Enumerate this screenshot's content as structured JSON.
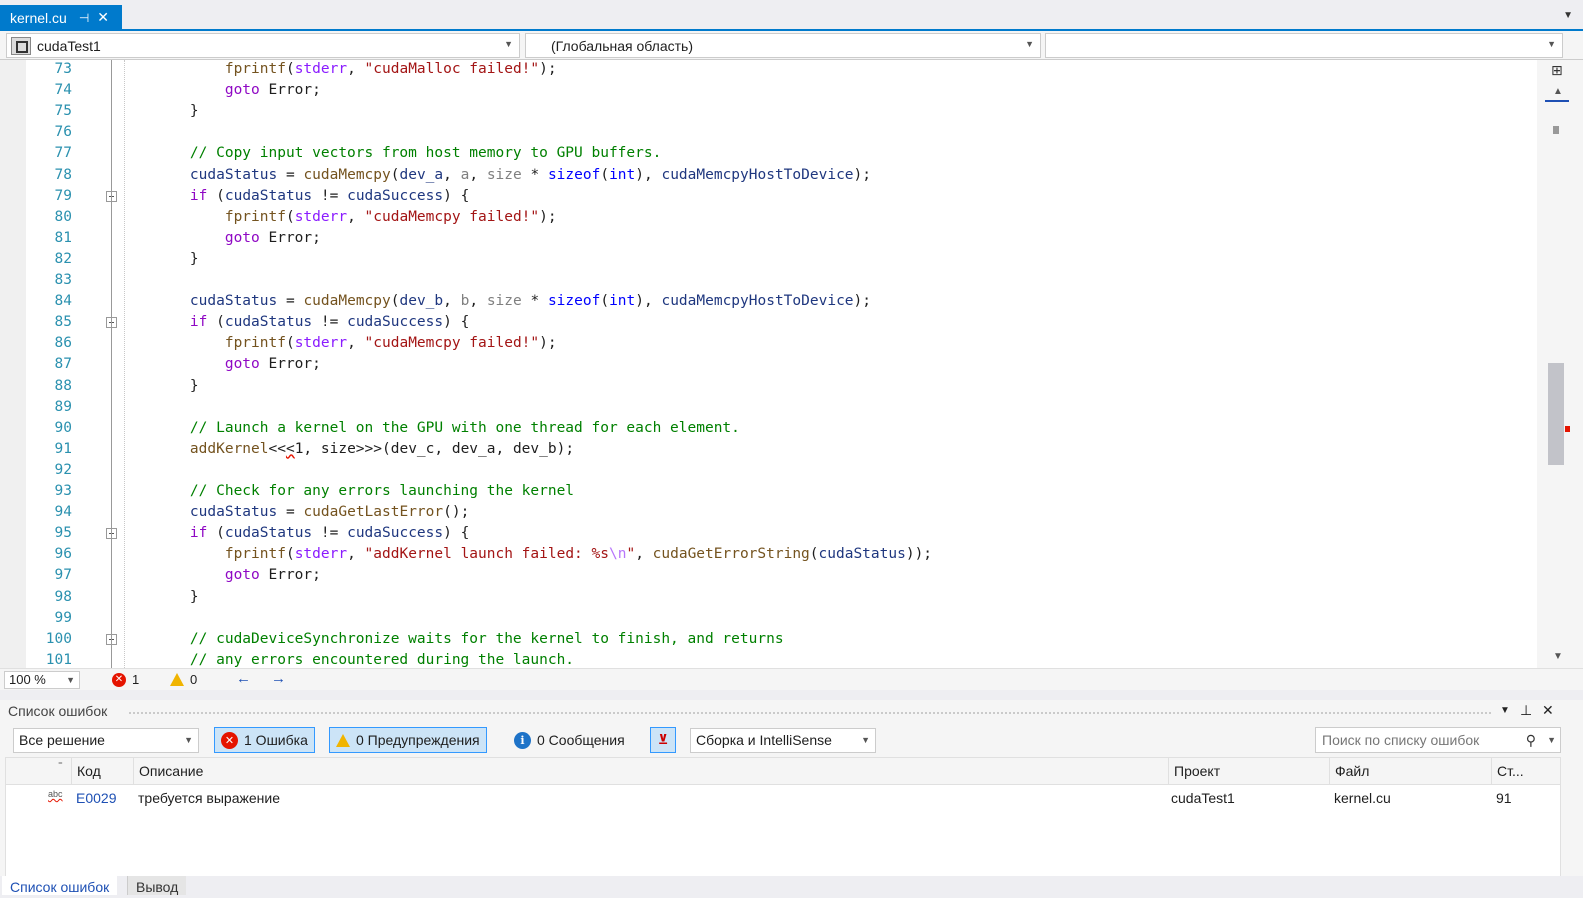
{
  "tab": {
    "filename": "kernel.cu",
    "pin": "⊣",
    "close": "✕"
  },
  "navbar": {
    "project": "cudaTest1",
    "scope": "(Глобальная область)",
    "member": ""
  },
  "editor": {
    "zoom": "100 %",
    "errors": "1",
    "warnings": "0",
    "lines": [
      {
        "n": "73",
        "fold": false,
        "html": "        <span class='fn'>fprintf</span>(<span class='glob'>stderr</span>, <span class='st'>\"cudaMalloc failed!\"</span>);"
      },
      {
        "n": "74",
        "fold": false,
        "html": "        <span class='kp'>goto</span> Error;"
      },
      {
        "n": "75",
        "fold": false,
        "html": "    }"
      },
      {
        "n": "76",
        "fold": false,
        "html": ""
      },
      {
        "n": "77",
        "fold": false,
        "html": "    <span class='cm'>// Copy input vectors from host memory to GPU buffers.</span>"
      },
      {
        "n": "78",
        "fold": false,
        "html": "    <span class='var'>cudaStatus</span> = <span class='fn'>cudaMemcpy</span>(<span class='var'>dev_a</span>, <span class='ps'>a</span>, <span class='ps'>size</span> * <span class='kw'>sizeof</span>(<span class='kw'>int</span>), <span class='var'>cudaMemcpyHostToDevice</span>);"
      },
      {
        "n": "79",
        "fold": true,
        "html": "    <span class='kp'>if</span> (<span class='var'>cudaStatus</span> != <span class='var'>cudaSuccess</span>) {"
      },
      {
        "n": "80",
        "fold": false,
        "html": "        <span class='fn'>fprintf</span>(<span class='glob'>stderr</span>, <span class='st'>\"cudaMemcpy failed!\"</span>);"
      },
      {
        "n": "81",
        "fold": false,
        "html": "        <span class='kp'>goto</span> Error;"
      },
      {
        "n": "82",
        "fold": false,
        "html": "    }"
      },
      {
        "n": "83",
        "fold": false,
        "html": ""
      },
      {
        "n": "84",
        "fold": false,
        "html": "    <span class='var'>cudaStatus</span> = <span class='fn'>cudaMemcpy</span>(<span class='var'>dev_b</span>, <span class='ps'>b</span>, <span class='ps'>size</span> * <span class='kw'>sizeof</span>(<span class='kw'>int</span>), <span class='var'>cudaMemcpyHostToDevice</span>);"
      },
      {
        "n": "85",
        "fold": true,
        "html": "    <span class='kp'>if</span> (<span class='var'>cudaStatus</span> != <span class='var'>cudaSuccess</span>) {"
      },
      {
        "n": "86",
        "fold": false,
        "html": "        <span class='fn'>fprintf</span>(<span class='glob'>stderr</span>, <span class='st'>\"cudaMemcpy failed!\"</span>);"
      },
      {
        "n": "87",
        "fold": false,
        "html": "        <span class='kp'>goto</span> Error;"
      },
      {
        "n": "88",
        "fold": false,
        "html": "    }"
      },
      {
        "n": "89",
        "fold": false,
        "html": ""
      },
      {
        "n": "90",
        "fold": false,
        "html": "    <span class='cm'>// Launch a kernel on the GPU with one thread for each element.</span>"
      },
      {
        "n": "91",
        "fold": false,
        "html": "    <span class='fn'>addKernel</span>&lt;&lt;<span class='squig'>&lt;</span>1, size&gt;&gt;&gt;(dev_c, dev_a, dev_b);"
      },
      {
        "n": "92",
        "fold": false,
        "html": ""
      },
      {
        "n": "93",
        "fold": false,
        "html": "    <span class='cm'>// Check for any errors launching the kernel</span>"
      },
      {
        "n": "94",
        "fold": false,
        "html": "    <span class='var'>cudaStatus</span> = <span class='fn'>cudaGetLastError</span>();"
      },
      {
        "n": "95",
        "fold": true,
        "html": "    <span class='kp'>if</span> (<span class='var'>cudaStatus</span> != <span class='var'>cudaSuccess</span>) {"
      },
      {
        "n": "96",
        "fold": false,
        "html": "        <span class='fn'>fprintf</span>(<span class='glob'>stderr</span>, <span class='st'>\"addKernel launch failed: %s</span><span class='esc'>\\n</span><span class='st'>\"</span>, <span class='fn'>cudaGetErrorString</span>(<span class='var'>cudaStatus</span>));"
      },
      {
        "n": "97",
        "fold": false,
        "html": "        <span class='kp'>goto</span> Error;"
      },
      {
        "n": "98",
        "fold": false,
        "html": "    }"
      },
      {
        "n": "99",
        "fold": false,
        "html": ""
      },
      {
        "n": "100",
        "fold": true,
        "html": "    <span class='cm'>// cudaDeviceSynchronize waits for the kernel to finish, and returns</span>"
      },
      {
        "n": "101",
        "fold": false,
        "html": "    <span class='cm'>// any errors encountered during the launch.</span>"
      }
    ]
  },
  "error_list": {
    "title": "Список ошибок",
    "scope": "Все решение",
    "errors_btn": "1 Ошибка",
    "warnings_btn": "0 Предупреждения",
    "messages_btn": "0 Сообщения",
    "source": "Сборка и IntelliSense",
    "search_placeholder": "Поиск по списку ошибок",
    "columns": {
      "code": "Код",
      "desc": "Описание",
      "project": "Проект",
      "file": "Файл",
      "line": "Ст..."
    },
    "rows": [
      {
        "code": "E0029",
        "desc": "требуется выражение",
        "project": "cudaTest1",
        "file": "kernel.cu",
        "line": "91"
      }
    ]
  },
  "bottom_tabs": {
    "errors": "Список ошибок",
    "output": "Вывод"
  }
}
